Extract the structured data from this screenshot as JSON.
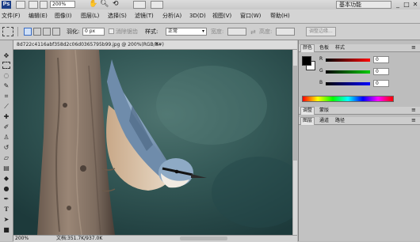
{
  "appbar": {
    "logo": "Ps",
    "zoom": "200%",
    "workspace": "基本功能",
    "window_controls": [
      "_",
      "□",
      "✕"
    ]
  },
  "menubar": {
    "items": [
      "文件(F)",
      "编辑(E)",
      "图像(I)",
      "图层(L)",
      "选择(S)",
      "滤镜(T)",
      "分析(A)",
      "3D(D)",
      "视图(V)",
      "窗口(W)",
      "帮助(H)"
    ]
  },
  "options": {
    "feather_label": "羽化:",
    "feather_value": "0 px",
    "antialias_label": "消除锯齿",
    "style_label": "样式:",
    "style_value": "正常",
    "width_label": "宽度:",
    "height_label": "高度:",
    "refine_edge": "调整边缘..."
  },
  "document": {
    "title": "8d722c4116abf358d2c06d0365795b99.jpg @ 200%(RGB/8#)",
    "zoom": "200%",
    "doc_info": "文档:351.7K/937.0K"
  },
  "panels": {
    "color_tabs": [
      "颜色",
      "色板",
      "样式"
    ],
    "channels": [
      {
        "label": "R",
        "value": "0"
      },
      {
        "label": "G",
        "value": "0"
      },
      {
        "label": "B",
        "value": "0"
      }
    ],
    "adjust_tabs": [
      "调整",
      "蒙版"
    ],
    "layer_tabs": [
      "图层",
      "通道",
      "路径"
    ]
  },
  "colors": {
    "ps_blue": "#1b3e87",
    "chrome": "#d4d4d4",
    "foreground": "#000000",
    "background": "#ffffff"
  }
}
